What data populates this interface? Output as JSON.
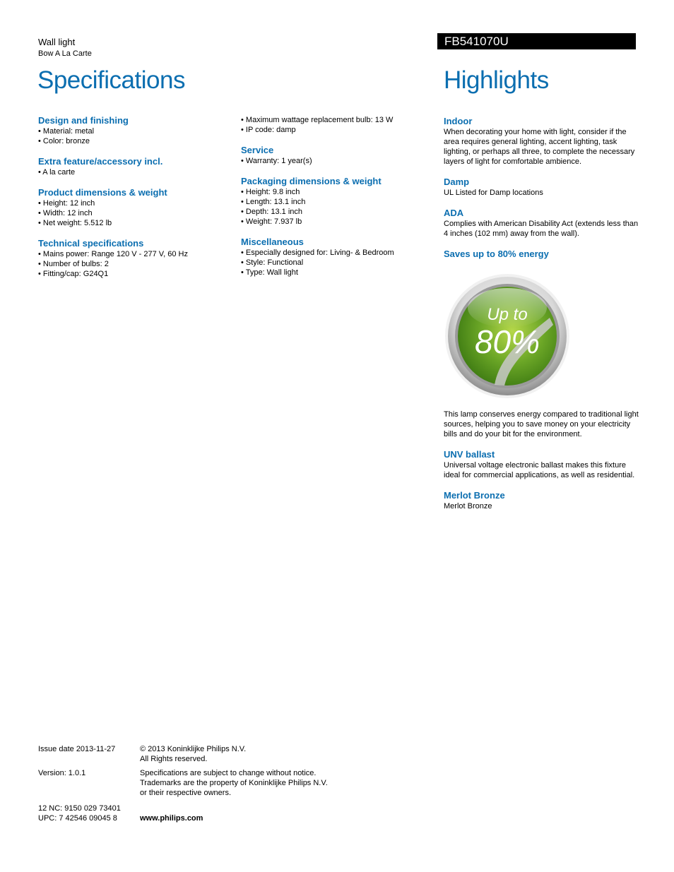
{
  "header": {
    "product_type": "Wall light",
    "product_name": "Bow A La Carte",
    "model": "FB541070U",
    "specifications_title": "Specifications",
    "highlights_title": "Highlights"
  },
  "colors": {
    "accent_blue": "#0b6eb0",
    "model_bar": "#000000",
    "badge_green": "#6aa526"
  },
  "specs_col1": [
    {
      "title": "Design and finishing",
      "items": [
        "• Material: metal",
        "• Color: bronze"
      ]
    },
    {
      "title": "Extra feature/accessory incl.",
      "items": [
        "• A la carte"
      ]
    },
    {
      "title": "Product dimensions & weight",
      "items": [
        "• Height: 12 inch",
        "• Width: 12 inch",
        "• Net weight: 5.512 lb"
      ]
    },
    {
      "title": "Technical specifications",
      "items": [
        "• Mains power: Range 120 V - 277 V, 60 Hz",
        "• Number of bulbs: 2",
        "• Fitting/cap: G24Q1"
      ]
    }
  ],
  "specs_col2_continued": [
    "• Maximum wattage replacement bulb: 13 W",
    "• IP code: damp"
  ],
  "specs_col2": [
    {
      "title": "Service",
      "items": [
        "• Warranty: 1 year(s)"
      ]
    },
    {
      "title": "Packaging dimensions & weight",
      "items": [
        "• Height: 9.8 inch",
        "• Length: 13.1 inch",
        "• Depth: 13.1 inch",
        "• Weight: 7.937 lb"
      ]
    },
    {
      "title": "Miscellaneous",
      "items": [
        "• Especially designed for: Living- & Bedroom",
        "• Style: Functional",
        "• Type: Wall light"
      ]
    }
  ],
  "highlights": [
    {
      "title": "Indoor",
      "text": "When decorating your home with light, consider if the area requires general lighting, accent lighting, task lighting, or perhaps all three, to complete the necessary layers of light for comfortable ambience."
    },
    {
      "title": "Damp",
      "text": "UL Listed for Damp locations"
    },
    {
      "title": "ADA",
      "text": "Complies with American Disability Act (extends less than 4 inches (102 mm) away from the wall)."
    },
    {
      "title": "Saves up to 80% energy",
      "text": "This lamp conserves energy compared to traditional light sources, helping you to save money on your electricity bills and do your bit for the environment."
    },
    {
      "title": "UNV ballast",
      "text": "Universal voltage electronic ballast makes this fixture ideal for commercial applications, as well as residential."
    },
    {
      "title": "Merlot Bronze",
      "text": "Merlot Bronze"
    }
  ],
  "badge": {
    "line1": "Up to",
    "line2": "80%"
  },
  "footer": {
    "issue_date": "Issue date 2013-11-27",
    "copyright_line1": "© 2013 Koninklijke Philips N.V.",
    "copyright_line2": "All Rights reserved.",
    "version": "Version: 1.0.1",
    "notice_line1": "Specifications are subject to change without notice.",
    "notice_line2": "Trademarks are the property of Koninklijke Philips N.V.",
    "notice_line3": "or their respective owners.",
    "nc": "12 NC: 9150 029 73401",
    "upc": "UPC: 7 42546 09045 8",
    "website": "www.philips.com"
  }
}
